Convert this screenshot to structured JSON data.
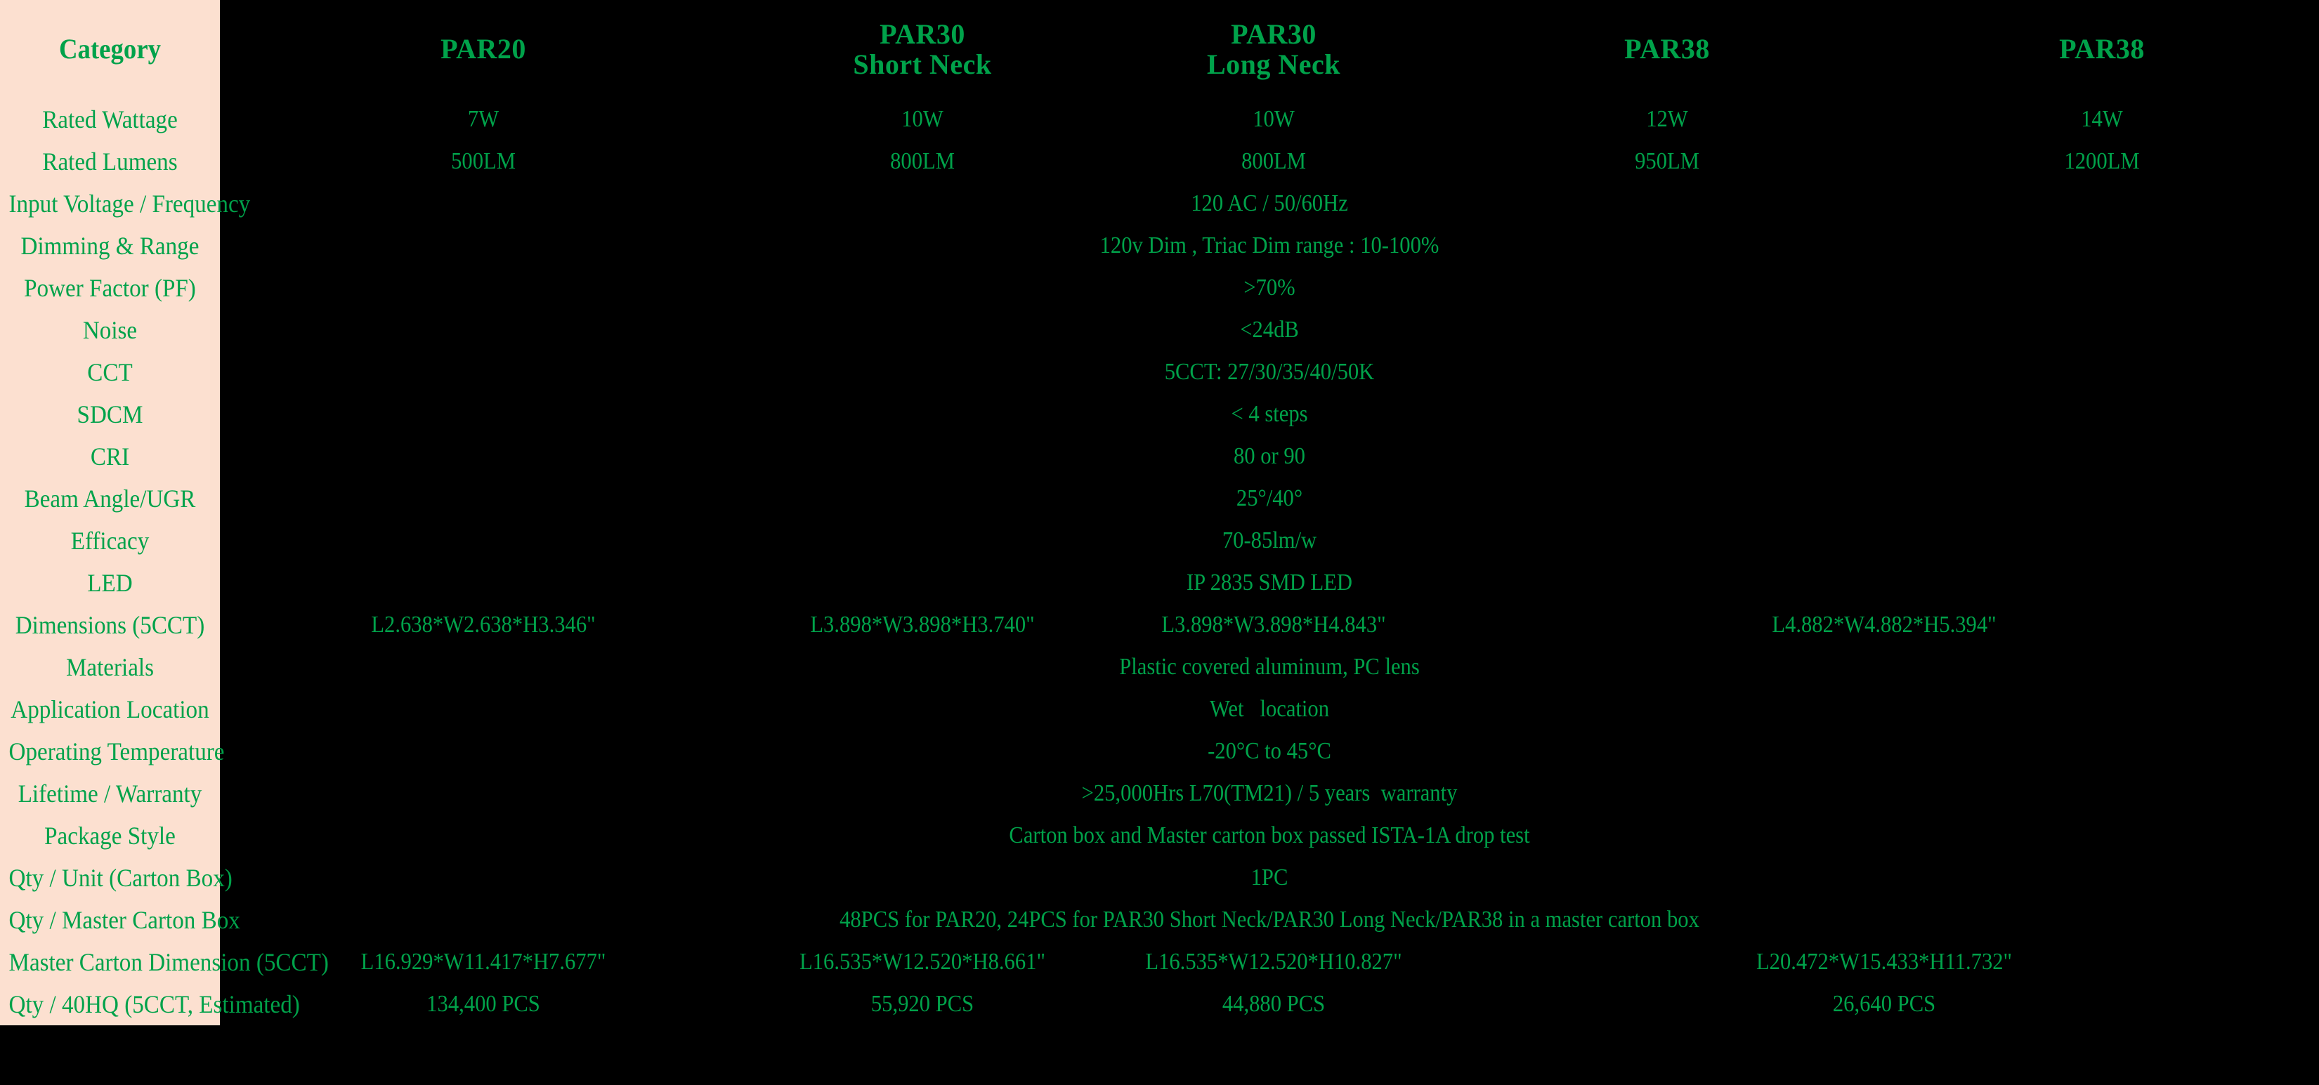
{
  "table": {
    "category_header": "Category",
    "columns": [
      {
        "line1": "PAR20",
        "line2": ""
      },
      {
        "line1": "PAR30",
        "line2": "Short Neck"
      },
      {
        "line1": "PAR30",
        "line2": "Long Neck"
      },
      {
        "line1": "PAR38",
        "line2": ""
      },
      {
        "line1": "PAR38",
        "line2": ""
      }
    ],
    "colors": {
      "text_green": "#00a24a",
      "label_bg": "#fce0d0",
      "page_bg": "#000000"
    },
    "rows": [
      {
        "label": "Rated Wattage",
        "type": "per-column",
        "values": [
          "7W",
          "10W",
          "10W",
          "12W",
          "14W"
        ]
      },
      {
        "label": "Rated Lumens",
        "type": "per-column",
        "values": [
          "500LM",
          "800LM",
          "800LM",
          "950LM",
          "1200LM"
        ]
      },
      {
        "label": "Input Voltage / Frequency",
        "type": "merged",
        "value": "120 AC / 50/60Hz"
      },
      {
        "label": "Dimming & Range",
        "type": "merged",
        "value": "120v Dim , Triac Dim range : 10-100%"
      },
      {
        "label": "Power Factor (PF)",
        "type": "merged",
        "value": ">70%"
      },
      {
        "label": "Noise",
        "type": "merged",
        "value": "<24dB"
      },
      {
        "label": "CCT",
        "type": "merged",
        "value": "5CCT: 27/30/35/40/50K"
      },
      {
        "label": "SDCM",
        "type": "merged",
        "value": "< 4 steps"
      },
      {
        "label": "CRI",
        "type": "merged",
        "value": "80 or 90"
      },
      {
        "label": "Beam Angle/UGR",
        "type": "merged",
        "value": "25°/40°"
      },
      {
        "label": "Efficacy",
        "type": "merged",
        "value": "70-85lm/w"
      },
      {
        "label": "LED",
        "type": "merged",
        "value": "IP 2835 SMD LED"
      },
      {
        "label": "Dimensions (5CCT)",
        "type": "dims",
        "values": [
          "L2.638*W2.638*H3.346\"",
          "L3.898*W3.898*H3.740\"",
          "L3.898*W3.898*H4.843\"",
          "L4.882*W4.882*H5.394\""
        ]
      },
      {
        "label": "Materials",
        "type": "merged",
        "value": "Plastic covered aluminum, PC lens"
      },
      {
        "label": "Application Location",
        "type": "merged",
        "value": "Wet   location"
      },
      {
        "label": "Operating Temperature",
        "type": "merged",
        "value": "-20°C to 45°C"
      },
      {
        "label": "Lifetime / Warranty",
        "type": "merged",
        "value": ">25,000Hrs L70(TM21) / 5 years  warranty"
      },
      {
        "label": "Package Style",
        "type": "merged",
        "value": "Carton box and Master carton box passed ISTA-1A drop test"
      },
      {
        "label": "Qty / Unit (Carton Box)",
        "type": "merged",
        "value": "1PC"
      },
      {
        "label": "Qty / Master Carton Box",
        "type": "merged",
        "value": "48PCS for PAR20, 24PCS for PAR30 Short Neck/PAR30 Long Neck/PAR38 in a master carton box"
      },
      {
        "label": "Master Carton Dimension (5CCT)",
        "type": "dims",
        "values": [
          "L16.929*W11.417*H7.677\"",
          "L16.535*W12.520*H8.661\"",
          "L16.535*W12.520*H10.827\"",
          "L20.472*W15.433*H11.732\""
        ]
      },
      {
        "label": "Qty / 40HQ (5CCT, Estimated)",
        "type": "dims",
        "values": [
          "134,400 PCS",
          "55,920 PCS",
          "44,880 PCS",
          "26,640 PCS"
        ]
      }
    ]
  }
}
